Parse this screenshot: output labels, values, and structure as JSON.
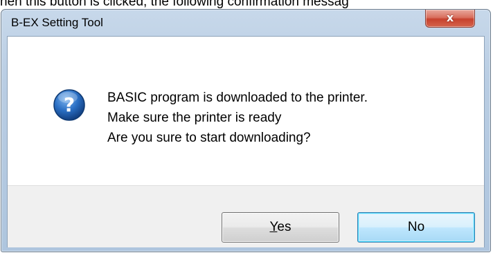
{
  "page_caption": "hen this button is clicked, the following confirmation messag",
  "dialog": {
    "title": "B-EX Setting Tool",
    "close_glyph": "x",
    "icon": "question-icon",
    "message_lines": [
      "BASIC program is downloaded to the printer.",
      "Make sure the printer is ready",
      "Are you sure to start downloading?"
    ],
    "buttons": {
      "yes_mnemonic": "Y",
      "yes_rest": "es",
      "no_label": "No"
    }
  },
  "colors": {
    "icon_blue": "#1c5fb3",
    "default_button_border": "#3c7fb1",
    "close_red": "#c7422e"
  }
}
